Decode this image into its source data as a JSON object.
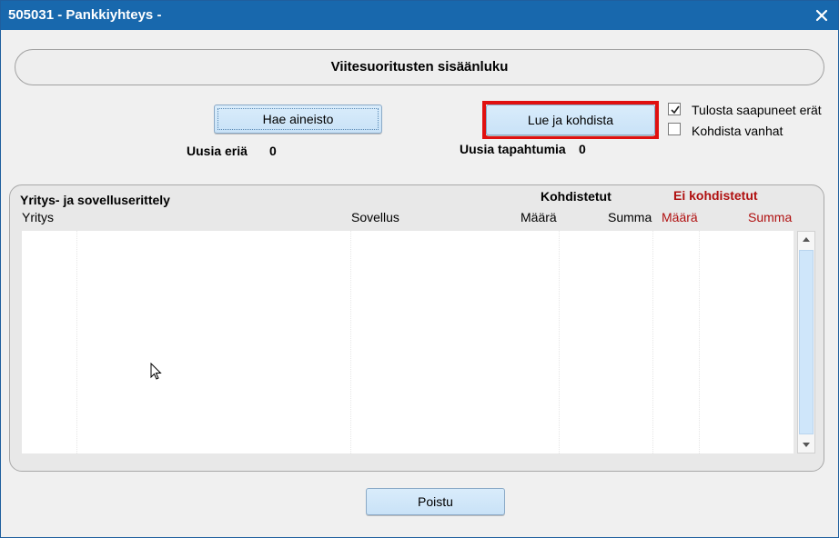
{
  "window": {
    "title": "505031 - Pankkiyhteys -",
    "close_icon": "close-icon"
  },
  "header": {
    "title": "Viitesuoritusten sisäänluku"
  },
  "actions": {
    "hae_label": "Hae aineisto",
    "lue_label": "Lue ja kohdista",
    "poistu_label": "Poistu"
  },
  "options": {
    "tulosta": {
      "label": "Tulosta saapuneet erät",
      "checked": true
    },
    "kohdista": {
      "label": "Kohdista vanhat",
      "checked": false
    }
  },
  "counters": {
    "uusia_eria_label": "Uusia eriä",
    "uusia_eria_value": "0",
    "uusia_tapahtumia_label": "Uusia tapahtumia",
    "uusia_tapahtumia_value": "0"
  },
  "breakdown": {
    "title": "Yritys- ja sovelluserittely",
    "group_kohdistetut": "Kohdistetut",
    "group_ei_kohdistetut": "Ei kohdistetut",
    "columns": {
      "yritys": "Yritys",
      "sovellus": "Sovellus",
      "maara": "Määrä",
      "summa": "Summa",
      "ei_maara": "Määrä",
      "ei_summa": "Summa"
    },
    "rows": []
  },
  "colors": {
    "titlebar": "#1868ad",
    "highlight_frame": "#e01010",
    "ei_kohdistetut_text": "#b01010",
    "button_fill": "#d0e6f9"
  }
}
